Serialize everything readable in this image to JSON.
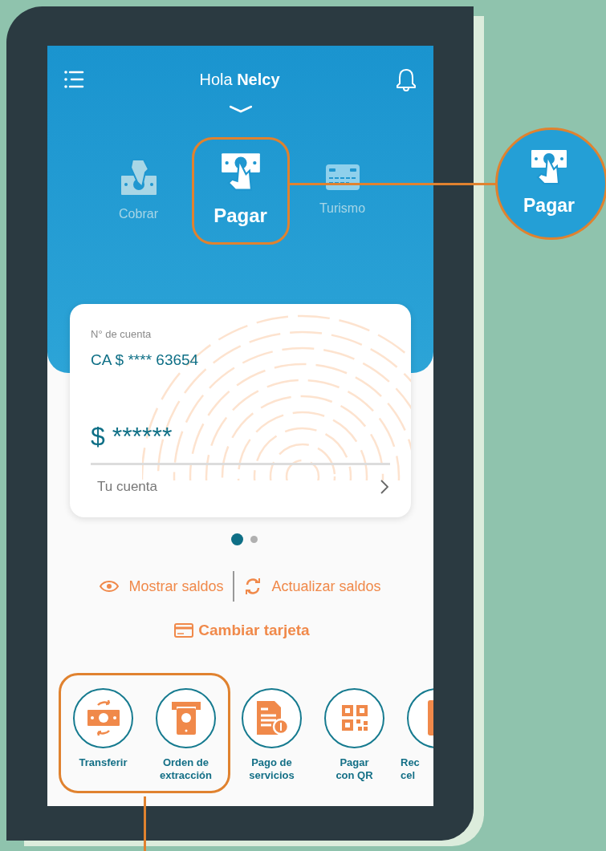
{
  "header": {
    "greeting": "Hola",
    "name": "Nelcy"
  },
  "options": [
    {
      "label": "Cobrar",
      "selected": false,
      "highlighted": false,
      "kind": "cobrar"
    },
    {
      "label": "Pagar",
      "selected": true,
      "highlighted": true,
      "kind": "pagar"
    },
    {
      "label": "Turismo",
      "selected": false,
      "highlighted": false,
      "kind": "turismo"
    }
  ],
  "account_card": {
    "label": "N° de cuenta",
    "account": "CA $ **** 63654",
    "balance": "$ ******",
    "link": "Tu cuenta"
  },
  "pager": [
    {
      "selected": true
    },
    {
      "selected": false
    }
  ],
  "actions": [
    {
      "label": "Mostrar saldos",
      "kind": "eye"
    },
    {
      "label": "Actualizar saldos",
      "kind": "refresh"
    }
  ],
  "change_card": "Cambiar tarjeta",
  "shortcuts": [
    {
      "lines": [
        "Transferir"
      ],
      "kind": "transfer",
      "highlighted": true
    },
    {
      "lines": [
        "Orden de",
        "extracción"
      ],
      "kind": "atm",
      "highlighted": true
    },
    {
      "lines": [
        "Pago de",
        "servicios"
      ],
      "kind": "bill",
      "highlighted": false
    },
    {
      "lines": [
        "Pagar",
        "con QR"
      ],
      "kind": "qr",
      "highlighted": false
    },
    {
      "lines": [
        "Rec",
        "cel"
      ],
      "kind": "phone",
      "highlighted": false
    }
  ],
  "callout": {
    "label": "Pagar"
  }
}
